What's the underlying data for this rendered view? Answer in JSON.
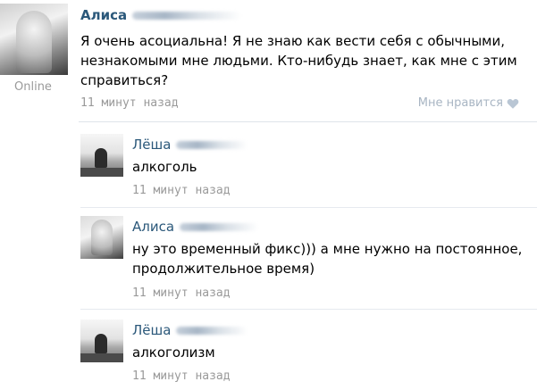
{
  "post": {
    "author": "Алиса",
    "status": "Online",
    "text": "Я очень асоциальна! Я не знаю как вести себя с обычными, незнакомыми мне людьми. Кто-нибудь знает, как мне с этим справиться?",
    "time": "11 минут назад",
    "like_label": "Мне нравится"
  },
  "comments": [
    {
      "author": "Лёша",
      "text": "алкоголь",
      "time": "11 минут назад"
    },
    {
      "author": "Алиса",
      "text": "ну это временный фикс))) а мне нужно на постоянное, продолжительное время)",
      "time": "11 минут назад"
    },
    {
      "author": "Лёша",
      "text": "алкоголизм",
      "time": "11 минут назад"
    }
  ],
  "colors": {
    "link": "#2b587a",
    "meta": "#9a9a9a",
    "separator": "#dfe4ea"
  },
  "icons": {
    "like": "heart-icon"
  }
}
